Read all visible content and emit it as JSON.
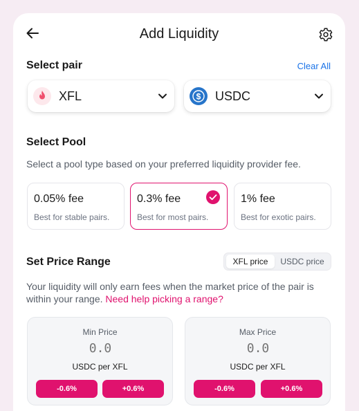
{
  "header": {
    "title": "Add Liquidity"
  },
  "select_pair": {
    "label": "Select pair",
    "clear_all": "Clear All",
    "token_a": {
      "name": "XFL",
      "icon": "flame-icon"
    },
    "token_b": {
      "name": "USDC",
      "icon": "usdc-icon"
    }
  },
  "select_pool": {
    "label": "Select Pool",
    "description": "Select a pool type based on your preferred liquidity provider fee.",
    "options": [
      {
        "fee": "0.05% fee",
        "sub": "Best for stable pairs.",
        "selected": false
      },
      {
        "fee": "0.3% fee",
        "sub": "Best for most pairs.",
        "selected": true
      },
      {
        "fee": "1% fee",
        "sub": "Best for exotic pairs.",
        "selected": false
      }
    ]
  },
  "price_range": {
    "label": "Set Price Range",
    "toggle": {
      "option_a": "XFL price",
      "option_b": "USDC price",
      "active": "XFL price"
    },
    "text": "Your liquidity will only earn fees when the market price of the pair is within your range.",
    "help_link": "Need help picking a range?",
    "min": {
      "label": "Min Price",
      "placeholder": "0.0",
      "unit": "USDC per XFL",
      "minus": "-0.6%",
      "plus": "+0.6%"
    },
    "max": {
      "label": "Max Price",
      "placeholder": "0.0",
      "unit": "USDC per XFL",
      "minus": "-0.6%",
      "plus": "+0.6%"
    }
  },
  "colors": {
    "accent": "#e0126e",
    "link": "#1a73e8",
    "background": "#f6ecf3"
  }
}
